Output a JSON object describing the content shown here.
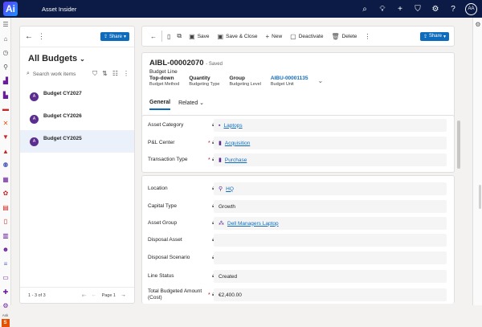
{
  "app": {
    "logo_text": "Ai",
    "name": "Asset Insider",
    "user_initials": "AA"
  },
  "topbar_icons": [
    "search-icon",
    "lightbulb-icon",
    "plus-icon",
    "filter-icon",
    "settings-icon",
    "help-icon"
  ],
  "leftnav": {
    "bottom_text": "Ask",
    "badge": "S"
  },
  "list": {
    "title": "All Budgets",
    "share_label": "Share",
    "search_placeholder": "Search work items",
    "records": [
      {
        "avatar": "A",
        "name": "Budget CY2027"
      },
      {
        "avatar": "A",
        "name": "Budget CY2026"
      },
      {
        "avatar": "A",
        "name": "Budget CY2025"
      }
    ],
    "footer": {
      "range": "1 - 3 of 3",
      "page": "Page 1"
    }
  },
  "commands": {
    "save": "Save",
    "save_close": "Save & Close",
    "new": "New",
    "deactivate": "Deactivate",
    "delete": "Delete",
    "share": "Share"
  },
  "record": {
    "title": "AIBL-00002070",
    "status": "- Saved",
    "entity": "Budget Line",
    "header_fields": [
      {
        "value": "Top-down",
        "label": "Budget Method"
      },
      {
        "value": "Quantity",
        "label": "Budgeting Type"
      },
      {
        "value": "Group",
        "label": "Budgeting Level"
      },
      {
        "value": "AIBU-00001135",
        "label": "Budget Unit"
      }
    ],
    "tabs": [
      "General",
      "Related"
    ]
  },
  "section1": [
    {
      "label": "Asset Category",
      "required": "",
      "value": "Laptops",
      "link": true,
      "icon": "▪"
    },
    {
      "label": "P&L Center",
      "required": "*",
      "value": "Acquisition",
      "link": true,
      "icon": "▮"
    },
    {
      "label": "Transaction Type",
      "required": "*",
      "value": "Purchase",
      "link": true,
      "icon": "▮"
    }
  ],
  "section2": [
    {
      "label": "Location",
      "required": "",
      "value": "HQ",
      "link": true,
      "icon": "⚲"
    },
    {
      "label": "Capital Type",
      "required": "",
      "value": "Growth",
      "link": false,
      "icon": ""
    },
    {
      "label": "Asset Group",
      "required": "",
      "value": "Dell Managers Laptop",
      "link": true,
      "icon": "⁂"
    },
    {
      "label": "Disposal Asset",
      "required": "",
      "value": "",
      "link": false,
      "icon": ""
    },
    {
      "label": "Disposal Scenario",
      "required": "",
      "value": "",
      "link": false,
      "icon": ""
    },
    {
      "label": "Line Status",
      "required": "",
      "value": "Created",
      "link": false,
      "icon": ""
    },
    {
      "label": "Total Budgeted Amount (Cost)",
      "required": "*",
      "value": "€2,400.00",
      "link": false,
      "icon": ""
    }
  ]
}
